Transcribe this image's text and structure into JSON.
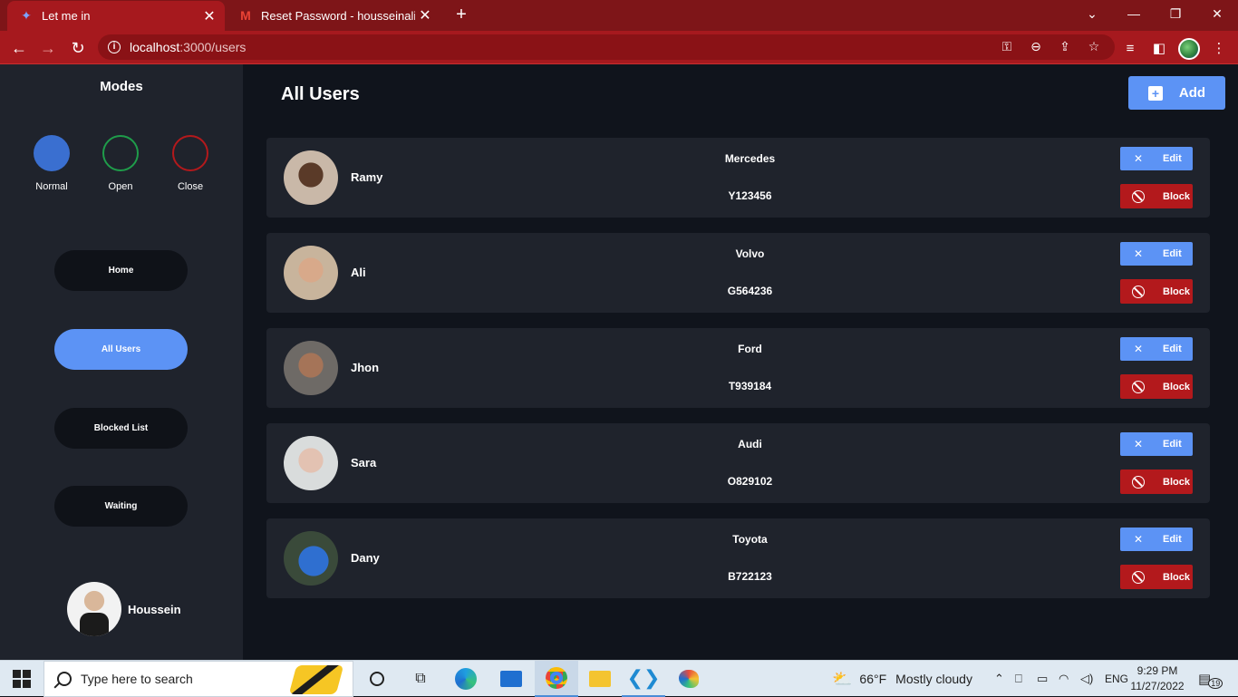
{
  "browser": {
    "tabs": [
      {
        "title": "Let me in",
        "favicon": "sprite-icon"
      },
      {
        "title": "Reset Password - housseinalialdr",
        "favicon": "gmail-icon"
      }
    ],
    "url_host": "localhost",
    "url_path": ":3000/users",
    "colors": {
      "tabbar": "#7e1518",
      "toolbar": "#a6191e"
    }
  },
  "sidebar": {
    "modes_title": "Modes",
    "modes": [
      {
        "label": "Normal",
        "color": "#3a6fd0",
        "style": "filled"
      },
      {
        "label": "Open",
        "color": "#1f9c4a",
        "style": "ring"
      },
      {
        "label": "Close",
        "color": "#b3191c",
        "style": "ring"
      }
    ],
    "nav": [
      {
        "label": "Home",
        "active": false
      },
      {
        "label": "All Users",
        "active": true
      },
      {
        "label": "Blocked List",
        "active": false
      },
      {
        "label": "Waiting",
        "active": false
      }
    ],
    "current_user": "Houssein"
  },
  "main": {
    "title": "All Users",
    "add_label": "Add",
    "edit_label": "Edit",
    "block_label": "Block",
    "users": [
      {
        "name": "Ramy",
        "car": "Mercedes",
        "plate": "Y123456"
      },
      {
        "name": "Ali",
        "car": "Volvo",
        "plate": "G564236"
      },
      {
        "name": "Jhon",
        "car": "Ford",
        "plate": "T939184"
      },
      {
        "name": "Sara",
        "car": "Audi",
        "plate": "O829102"
      },
      {
        "name": "Dany",
        "car": "Toyota",
        "plate": "B722123"
      }
    ],
    "colors": {
      "accent": "#5c93f5",
      "danger": "#b3191c",
      "card": "#1f232c",
      "background": "#10141c"
    }
  },
  "taskbar": {
    "search_placeholder": "Type here to search",
    "weather": "66°F",
    "weather_desc": "Mostly cloudy",
    "lang": "ENG",
    "time": "9:29 PM",
    "date": "11/27/2022",
    "notifications": "19"
  }
}
